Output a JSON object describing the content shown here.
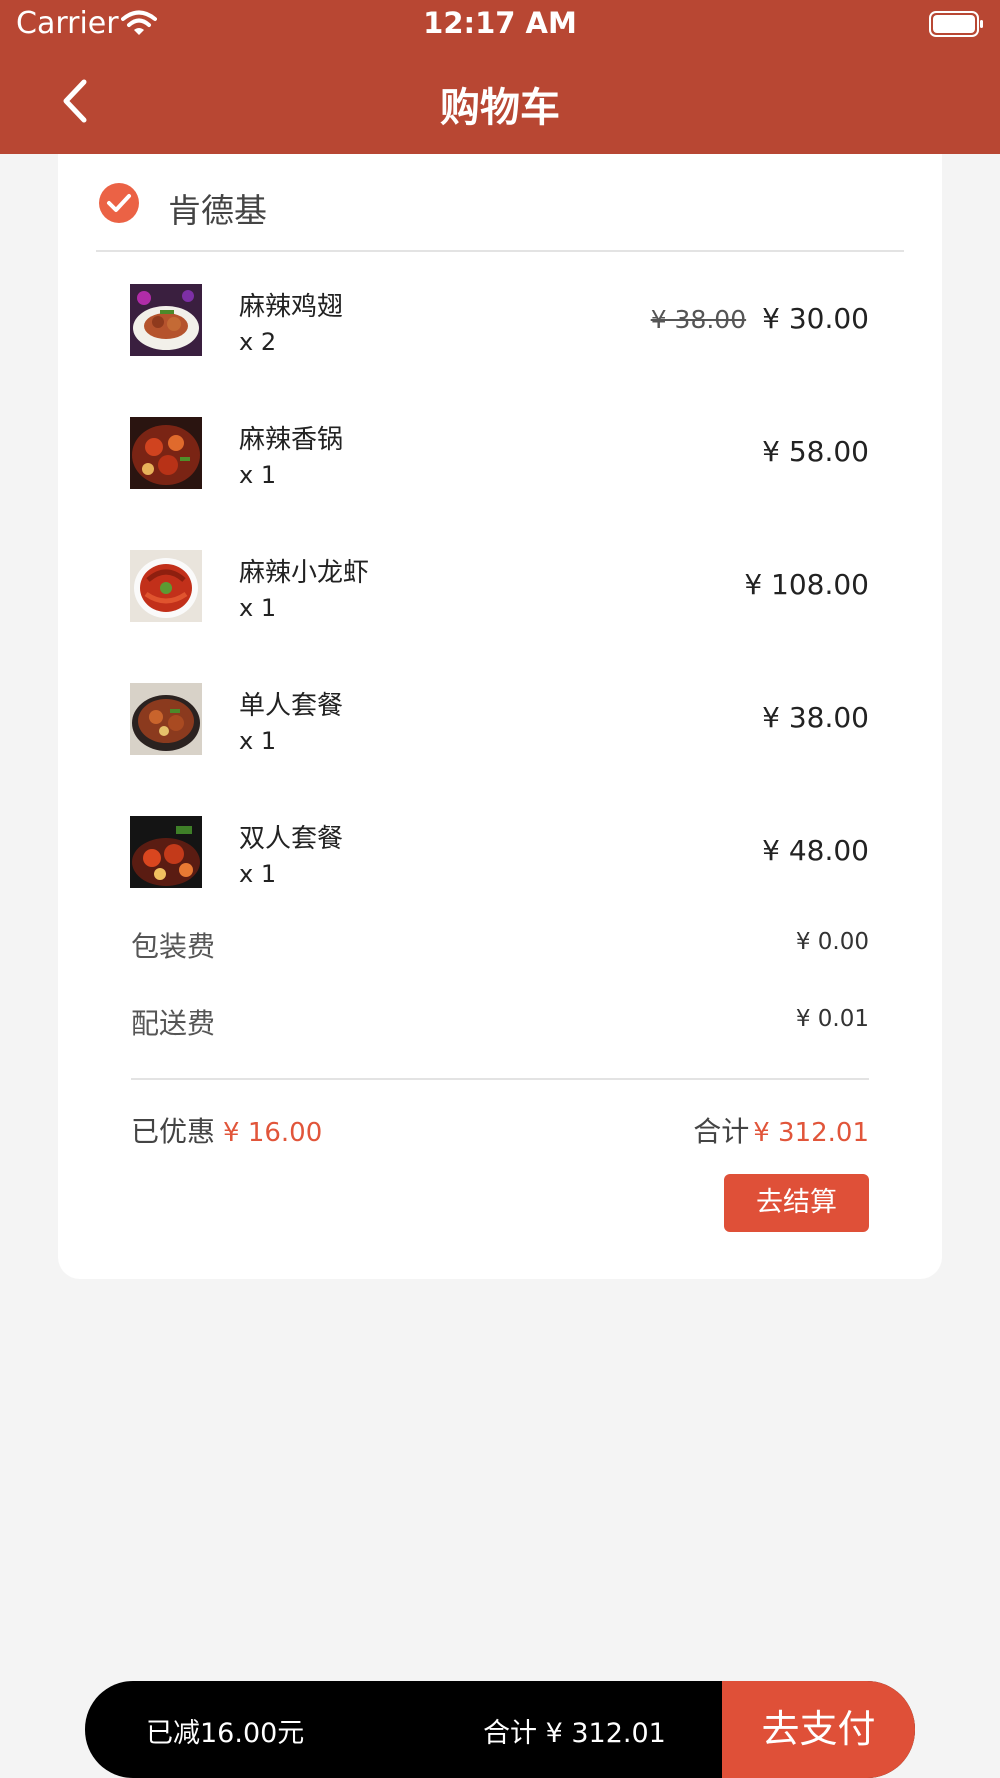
{
  "status_bar": {
    "carrier": "Carrier",
    "time": "12:17 AM"
  },
  "nav": {
    "title": "购物车"
  },
  "shop": {
    "name": "肯德基",
    "selected": true
  },
  "items": [
    {
      "name": "麻辣鸡翅",
      "qty": "x 2",
      "old_price": "¥ 38.00",
      "price": "¥ 30.00"
    },
    {
      "name": "麻辣香锅",
      "qty": "x 1",
      "price": "¥ 58.00"
    },
    {
      "name": "麻辣小龙虾",
      "qty": "x 1",
      "price": "¥ 108.00"
    },
    {
      "name": "单人套餐",
      "qty": "x 1",
      "price": "¥ 38.00"
    },
    {
      "name": "双人套餐",
      "qty": "x 1",
      "price": "¥ 48.00"
    }
  ],
  "fees": {
    "packing_label": "包装费",
    "packing_value": "¥ 0.00",
    "delivery_label": "配送费",
    "delivery_value": "¥ 0.01"
  },
  "summary": {
    "discount_label": "已优惠",
    "discount_value": "¥ 16.00",
    "total_label": "合计",
    "total_value": "¥ 312.01",
    "checkout_label": "去结算"
  },
  "pay_bar": {
    "reduced_text": "已减16.00元",
    "total_text": "合计 ¥ 312.01",
    "pay_label": "去支付"
  },
  "colors": {
    "header": "#b84733",
    "accent": "#df5038",
    "pay_bar": "#000000"
  }
}
